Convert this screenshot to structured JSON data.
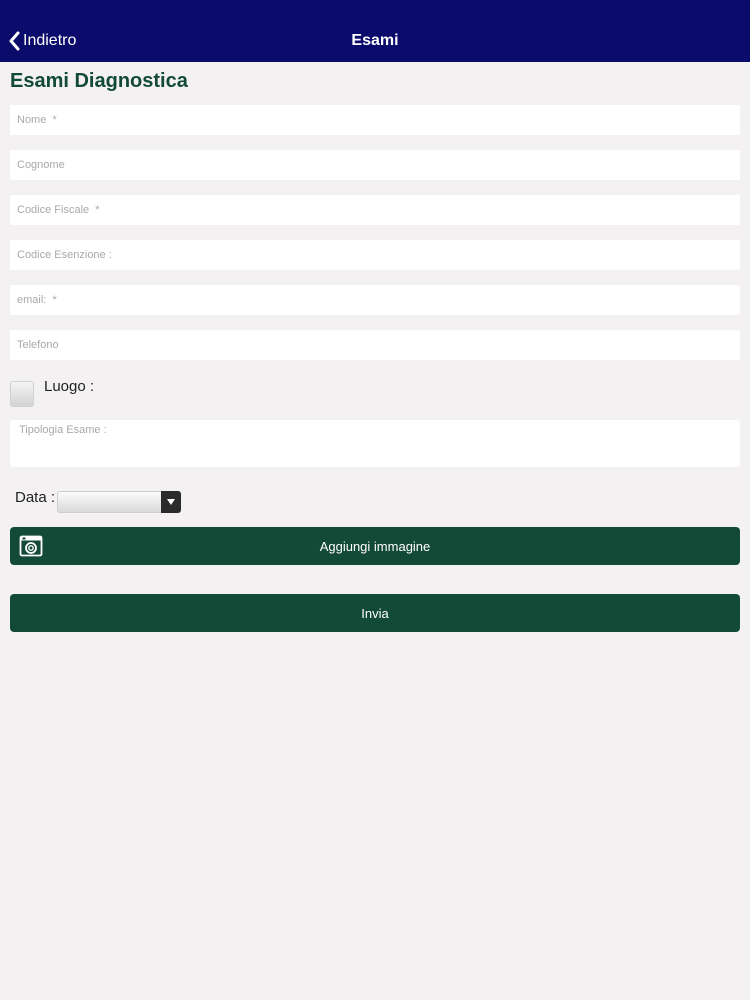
{
  "navbar": {
    "back_label": "Indietro",
    "title": "Esami",
    "background_color": "#0b0b6b"
  },
  "page_title": "Esami Diagnostica",
  "form": {
    "fields": {
      "nome": {
        "placeholder": "Nome  *",
        "value": ""
      },
      "cognome": {
        "placeholder": "Cognome",
        "value": ""
      },
      "codice_fiscale": {
        "placeholder": "Codice Fiscale  *",
        "value": ""
      },
      "codice_esenzione": {
        "placeholder": "Codice Esenzione :",
        "value": ""
      },
      "email": {
        "placeholder": "email:  *",
        "value": ""
      },
      "telefono": {
        "placeholder": "Telefono",
        "value": ""
      }
    },
    "luogo": {
      "label": "Luogo :",
      "checked": false
    },
    "tipologia_esame": {
      "placeholder": "Tipologia Esame :",
      "value": ""
    },
    "data": {
      "label": "Data :",
      "selected": ""
    },
    "add_image_button": {
      "label": "Aggiungi immagine",
      "icon": "camera-icon"
    },
    "send_button": {
      "label": "Invia"
    }
  },
  "colors": {
    "accent_green": "#134a37",
    "page_background": "#f3f1f1"
  }
}
